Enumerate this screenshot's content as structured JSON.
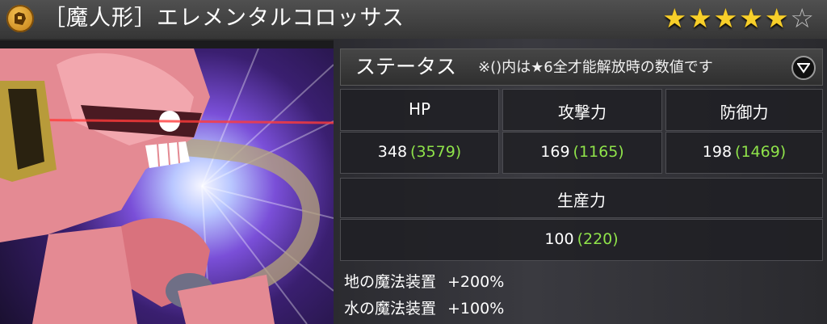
{
  "header": {
    "badge_icon": "golem-class-badge-icon",
    "title": "［魔人形］エレメンタルコロッサス",
    "rating": {
      "filled": 5,
      "total": 6
    },
    "star_filled_glyph": "★",
    "star_empty_glyph": "☆"
  },
  "status": {
    "title": "ステータス",
    "note": "※()内は★6全才能解放時の数値です",
    "dropdown_icon": "chevron-down-icon"
  },
  "stats": {
    "hp": {
      "label": "HP",
      "base": "348",
      "max": "(3579)"
    },
    "attack": {
      "label": "攻撃力",
      "base": "169",
      "max": "(1165)"
    },
    "defense": {
      "label": "防御力",
      "base": "198",
      "max": "(1469)"
    },
    "production": {
      "label": "生産力",
      "base": "100",
      "max": "(220)"
    }
  },
  "bonuses": [
    {
      "name": "地の魔法装置",
      "value": "+200%"
    },
    {
      "name": "水の魔法装置",
      "value": "+100%"
    }
  ],
  "colors": {
    "star": "#f7cf2a",
    "max_value": "#8fe34a",
    "robot_body": "#e48a93"
  }
}
